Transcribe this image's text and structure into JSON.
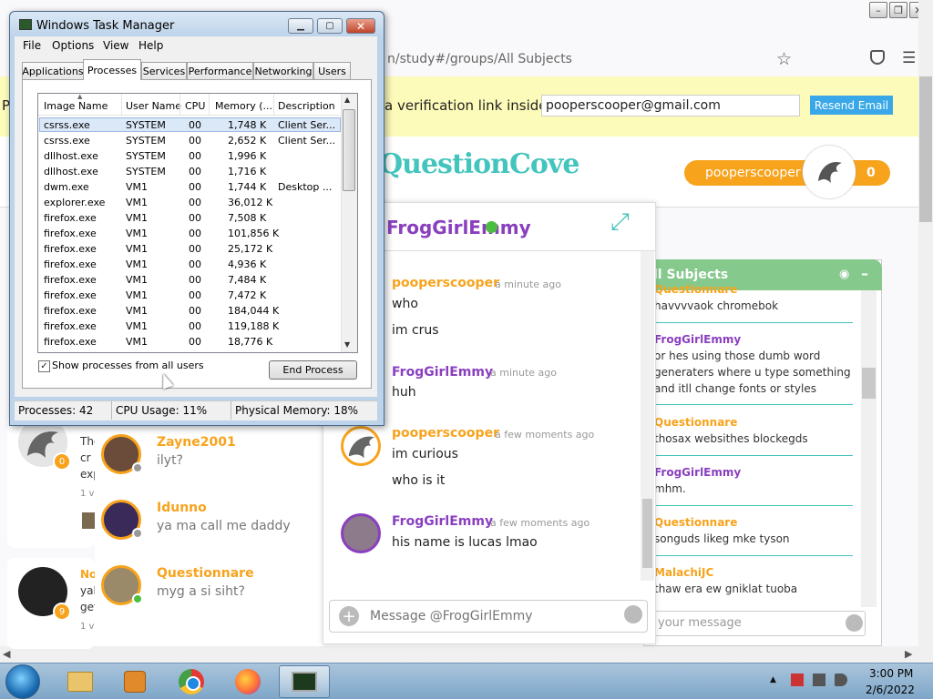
{
  "browser": {
    "url": "n/study#/groups/All Subjects",
    "banner_prefix": "P",
    "banner_text": "a verification link inside.",
    "email_value": "pooperscooper@gmail.com",
    "resend_label": "Resend Email"
  },
  "site": {
    "logo": "QuestionCove",
    "username": "pooperscooper",
    "user_count": "0"
  },
  "feed": {
    "card1_badge": "0",
    "card1_lines": [
      "The",
      "cr",
      "exp",
      "1 vi"
    ],
    "card2_badge": "9",
    "card2_lines": [
      "No",
      "yal",
      "get",
      "1 vi"
    ]
  },
  "friends": [
    {
      "name": "Zayne2001",
      "msg": "ilyt?",
      "status_color": "#999999"
    },
    {
      "name": "Idunno",
      "msg": "ya ma call me daddy",
      "status_color": "#999999"
    },
    {
      "name": "Questionnare",
      "msg": "myg a si siht?",
      "status_color": "#4cbe3f"
    }
  ],
  "chat": {
    "title": "FrogGirlEmmy",
    "input_placeholder": "Message @FrogGirlEmmy",
    "messages": [
      {
        "name": "pooperscooper",
        "time": "a minute ago",
        "lines": [
          "who",
          "im crus"
        ]
      },
      {
        "name": "FrogGirlEmmy",
        "time": "a minute ago",
        "lines": [
          "huh"
        ]
      },
      {
        "name": "pooperscooper",
        "time": "a few moments ago",
        "lines": [
          "im curious",
          "who is it"
        ]
      },
      {
        "name": "FrogGirlEmmy",
        "time": "a few moments ago",
        "lines": [
          "his name is lucas lmao"
        ]
      }
    ]
  },
  "group": {
    "title": "ll Subjects",
    "input_placeholder": "your message",
    "messages": [
      {
        "name": "Questionnare",
        "text": "havvvvaok chromebok"
      },
      {
        "name": "FrogGirlEmmy",
        "text": "or hes using those dumb word generaters where u type something and itll change fonts or styles"
      },
      {
        "name": "Questionnare",
        "text": "thosax websithes blockegds"
      },
      {
        "name": "FrogGirlEmmy",
        "text": "mhm."
      },
      {
        "name": "Questionnare",
        "text": "songuds likeg mke tyson"
      },
      {
        "name": "MalachiJC",
        "text": "thaw era ew gniklat tuoba"
      }
    ]
  },
  "taskmanager": {
    "title": "Windows Task Manager",
    "menus": [
      "File",
      "Options",
      "View",
      "Help"
    ],
    "tabs": [
      "Applications",
      "Processes",
      "Services",
      "Performance",
      "Networking",
      "Users"
    ],
    "active_tab": "Processes",
    "columns": [
      "Image Name",
      "User Name",
      "CPU",
      "Memory (...",
      "Description"
    ],
    "rows": [
      [
        "csrss.exe",
        "SYSTEM",
        "00",
        "1,748 K",
        "Client Ser..."
      ],
      [
        "csrss.exe",
        "SYSTEM",
        "00",
        "2,652 K",
        "Client Ser..."
      ],
      [
        "dllhost.exe",
        "SYSTEM",
        "00",
        "1,996 K",
        ""
      ],
      [
        "dllhost.exe",
        "SYSTEM",
        "00",
        "1,716 K",
        ""
      ],
      [
        "dwm.exe",
        "VM1",
        "00",
        "1,744 K",
        "Desktop ..."
      ],
      [
        "explorer.exe",
        "VM1",
        "00",
        "36,012 K",
        ""
      ],
      [
        "firefox.exe",
        "VM1",
        "00",
        "7,508 K",
        ""
      ],
      [
        "firefox.exe",
        "VM1",
        "00",
        "101,856 K",
        ""
      ],
      [
        "firefox.exe",
        "VM1",
        "00",
        "25,172 K",
        ""
      ],
      [
        "firefox.exe",
        "VM1",
        "00",
        "4,936 K",
        ""
      ],
      [
        "firefox.exe",
        "VM1",
        "00",
        "7,484 K",
        ""
      ],
      [
        "firefox.exe",
        "VM1",
        "00",
        "7,472 K",
        ""
      ],
      [
        "firefox.exe",
        "VM1",
        "00",
        "184,044 K",
        ""
      ],
      [
        "firefox.exe",
        "VM1",
        "00",
        "119,188 K",
        ""
      ],
      [
        "firefox.exe",
        "VM1",
        "00",
        "18,776 K",
        ""
      ]
    ],
    "show_all_label": "Show processes from all users",
    "show_all_checked": true,
    "end_process_label": "End Process",
    "status": {
      "processes": "Processes: 42",
      "cpu": "CPU Usage: 11%",
      "memory": "Physical Memory: 18%"
    }
  },
  "taskbar": {
    "apps": [
      "explorer-icon",
      "media-player-icon",
      "chrome-icon",
      "firefox-icon",
      "task-manager-icon"
    ],
    "time": "3:00 PM",
    "date": "2/6/2022"
  }
}
